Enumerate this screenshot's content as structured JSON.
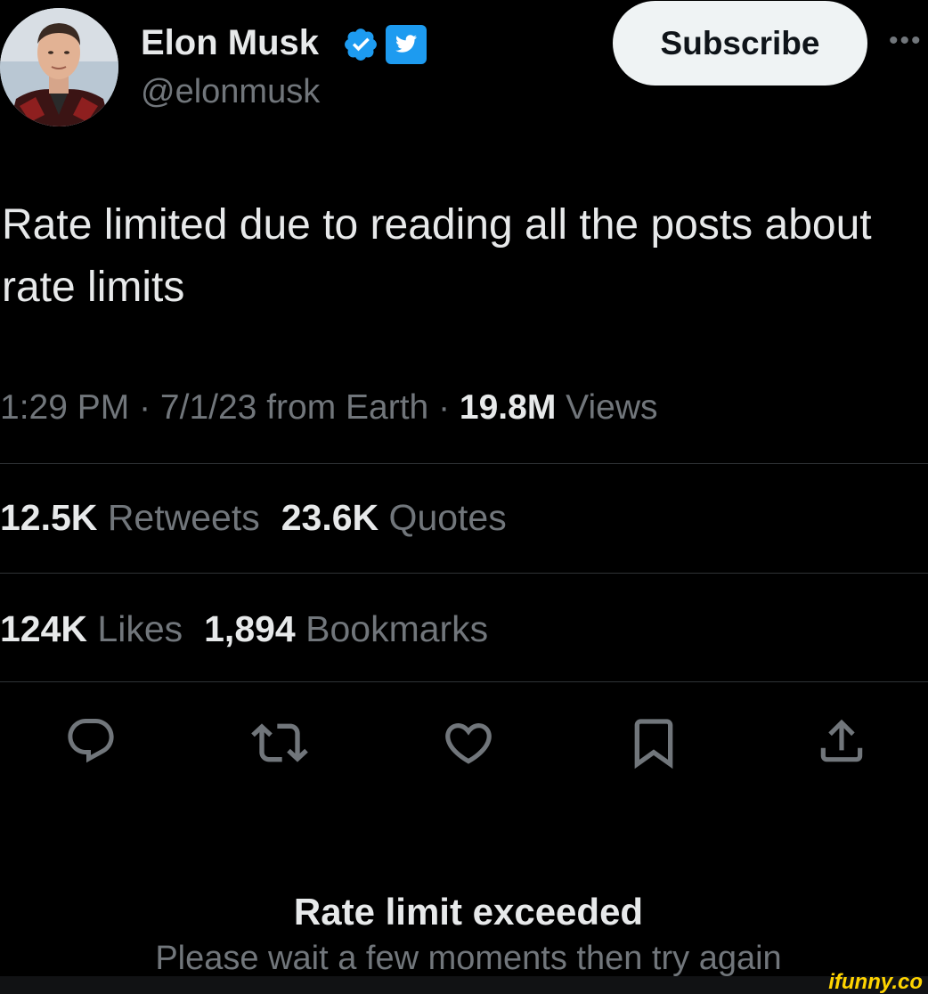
{
  "author": {
    "name": "Elon Musk",
    "handle": "@elonmusk",
    "verified_color": "#1d9bf0",
    "badge_icon": "twitter-bird-icon"
  },
  "header": {
    "subscribe_label": "Subscribe",
    "more_icon": "more-dots-icon",
    "more_label": "•••"
  },
  "tweet": {
    "text_line1": "Rate limited due to reading all the posts about",
    "text_line2": "rate limits"
  },
  "meta": {
    "time": "1:29 PM",
    "separator1": " · ",
    "date": "7/1/23",
    "source": " from Earth",
    "separator2": " · ",
    "views_count": "19.8M",
    "views_label": " Views"
  },
  "stats": {
    "retweets_count": "12.5K",
    "retweets_label": " Retweets",
    "quotes_count": "23.6K",
    "quotes_label": " Quotes",
    "likes_count": "124K",
    "likes_label": " Likes",
    "bookmarks_count": "1,894",
    "bookmarks_label": " Bookmarks"
  },
  "actions": [
    "reply-icon",
    "retweet-icon",
    "like-icon",
    "bookmark-icon",
    "share-icon"
  ],
  "rate_limit": {
    "title": "Rate limit exceeded",
    "message": "Please wait a few moments then try again"
  },
  "watermark": {
    "text": "ifunny.co",
    "color": "#ffd400"
  }
}
